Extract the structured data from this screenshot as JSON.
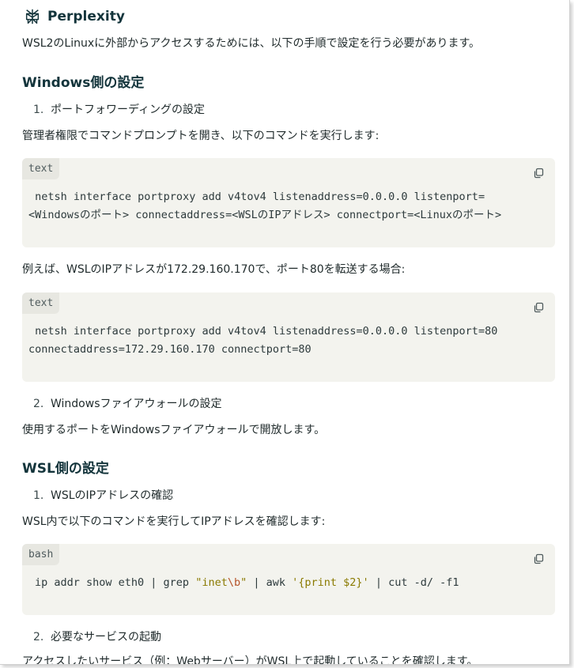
{
  "brand": {
    "name": "Perplexity"
  },
  "intro": "WSL2のLinuxに外部からアクセスするためには、以下の手順で設定を行う必要があります。",
  "section1": {
    "title": "Windows側の設定",
    "step1": {
      "num": "1.",
      "text": "ポートフォワーディングの設定"
    },
    "desc1": "管理者権限でコマンドプロンプトを開き、以下のコマンドを実行します:",
    "code1": {
      "lang": "text",
      "line1": " netsh interface portproxy add v4tov4 listenaddress=0.0.0.0 listenport=",
      "line2": "<Windowsのポート> connectaddress=<WSLのIPアドレス> connectport=<Linuxのポート>"
    },
    "desc2": "例えば、WSLのIPアドレスが172.29.160.170で、ポート80を転送する場合:",
    "code2": {
      "lang": "text",
      "line1": " netsh interface portproxy add v4tov4 listenaddress=0.0.0.0 listenport=80",
      "line2": "connectaddress=172.29.160.170 connectport=80"
    },
    "step2": {
      "num": "2.",
      "text": "Windowsファイアウォールの設定"
    },
    "desc3": "使用するポートをWindowsファイアウォールで開放します。"
  },
  "section2": {
    "title": "WSL側の設定",
    "step1": {
      "num": "1.",
      "text": "WSLのIPアドレスの確認"
    },
    "desc1": "WSL内で以下のコマンドを実行してIPアドレスを確認します:",
    "code1": {
      "lang": "bash",
      "part1": "ip addr show eth0 | grep ",
      "str1a": "\"inet",
      "str1esc": "\\b",
      "str1b": "\"",
      "part2": " | awk ",
      "str2": "'{print $2}'",
      "part3": " | cut -d/ -f1"
    },
    "step2": {
      "num": "2.",
      "text": "必要なサービスの起動"
    },
    "desc2": "アクセスしたいサービス（例：Webサーバー）がWSL上で起動していることを確認します。"
  },
  "icons": {
    "brand": "perplexity-logo-icon",
    "copy": "copy-icon"
  }
}
